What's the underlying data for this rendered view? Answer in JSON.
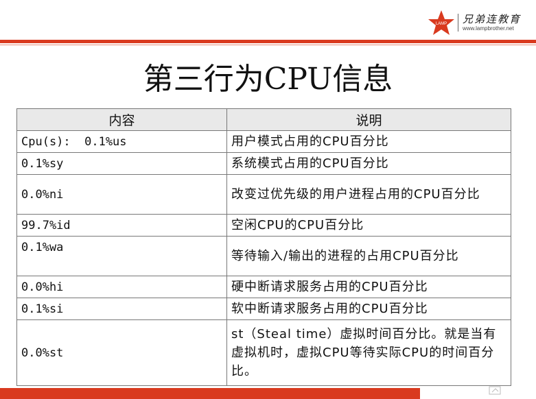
{
  "logo": {
    "brand": "兄弟连教育",
    "url": "www.lampbrother.net",
    "star_label": "LAMP"
  },
  "title": "第三行为CPU信息",
  "table": {
    "headers": [
      "内容",
      "说明"
    ],
    "rows": [
      {
        "content": "Cpu(s):  0.1%us",
        "desc": "用户模式占用的CPU百分比"
      },
      {
        "content": "0.1%sy",
        "desc": "系统模式占用的CPU百分比"
      },
      {
        "content": "0.0%ni",
        "desc": "改变过优先级的用户进程占用的CPU百分比"
      },
      {
        "content": "99.7%id",
        "desc": "空闲CPU的CPU百分比"
      },
      {
        "content": "0.1%wa",
        "desc": "等待输入/输出的进程的占用CPU百分比"
      },
      {
        "content": "0.0%hi",
        "desc": "硬中断请求服务占用的CPU百分比"
      },
      {
        "content": "0.1%si",
        "desc": "软中断请求服务占用的CPU百分比"
      },
      {
        "content": "0.0%st",
        "desc": "st（Steal time）虚拟时间百分比。就是当有虚拟机时，虚拟CPU等待实际CPU的时间百分比。"
      }
    ]
  },
  "colors": {
    "accent_red": "#d93a1f",
    "header_bg": "#e9e9e9"
  }
}
